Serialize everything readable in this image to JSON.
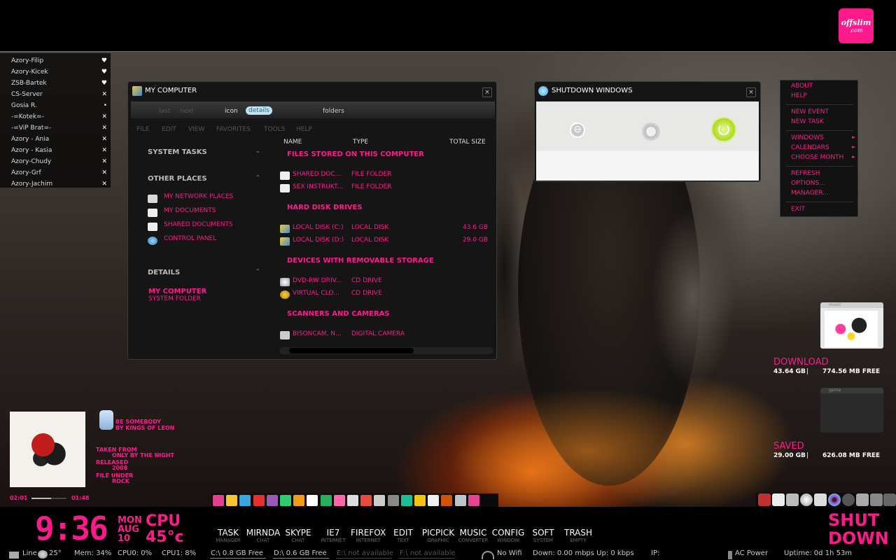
{
  "logo": {
    "line1": "offslim",
    "line2": ".com"
  },
  "buddies": [
    {
      "name": "Azory-Filip",
      "status": "♥"
    },
    {
      "name": "Azory-Kicek",
      "status": "♥"
    },
    {
      "name": "ZSB-Bartek",
      "status": "♥"
    },
    {
      "name": "CS-Server",
      "status": "✕"
    },
    {
      "name": "Gosia R.",
      "status": "•"
    },
    {
      "name": "-=Kotek=-",
      "status": "✕"
    },
    {
      "name": "-=ViP Brat=-",
      "status": "✕"
    },
    {
      "name": "Azory - Ania",
      "status": "✕"
    },
    {
      "name": "Azory - Kasia",
      "status": "✕"
    },
    {
      "name": "Azory-Chudy",
      "status": "✕"
    },
    {
      "name": "Azory-Grf",
      "status": "✕"
    },
    {
      "name": "Azory-Jachim",
      "status": "✕"
    }
  ],
  "my_computer": {
    "title": "MY COMPUTER",
    "close": "×",
    "nav": {
      "last": "last",
      "next": "next",
      "icon": "icon",
      "details": "details",
      "folders": "folders"
    },
    "menu": [
      "FILE",
      "EDIT",
      "VIEW",
      "FAVORITES",
      "TOOLS",
      "HELP"
    ],
    "sidebar": {
      "system_tasks": "SYSTEM TASKS",
      "other_places": "OTHER PLACES",
      "places": [
        "MY NETWORK PLACES",
        "MY DOCUMENTS",
        "SHARED DOCUMENTS",
        "CONTROL PANEL"
      ],
      "details": "DETAILS",
      "detail_title": "MY COMPUTER",
      "detail_sub": "SYSTEM FOLDER"
    },
    "columns": {
      "name": "NAME",
      "type": "TYPE",
      "size": "TOTAL SIZE"
    },
    "sections": [
      {
        "title": "FILES STORED ON THIS COMPUTER",
        "rows": [
          {
            "name": "SHARED DOC...",
            "type": "FILE FOLDER",
            "size": ""
          },
          {
            "name": "SEX INSTRUKT...",
            "type": "FILE FOLDER",
            "size": ""
          }
        ]
      },
      {
        "title": "HARD DISK DRIVES",
        "rows": [
          {
            "name": "LOCAL DISK (C:)",
            "type": "LOCAL DISK",
            "size": "43.6 GB"
          },
          {
            "name": "LOCAL DISK (D:)",
            "type": "LOCAL DISK",
            "size": "29.0 GB"
          }
        ]
      },
      {
        "title": "DEVICES WITH REMOVABLE STORAGE",
        "rows": [
          {
            "name": "DVD-RW DRIV...",
            "type": "CD DRIVE",
            "size": ""
          },
          {
            "name": "VIRTUAL CLO...",
            "type": "CD DRIVE",
            "size": ""
          }
        ]
      },
      {
        "title": "SCANNERS AND CAMERAS",
        "rows": [
          {
            "name": "BISONCAM, N...",
            "type": "DIGITAL CAMERA",
            "size": ""
          }
        ]
      }
    ]
  },
  "shutdown": {
    "title": "SHUTDOWN WINDOWS",
    "close": "×"
  },
  "context_menu": {
    "about": "ABOUT",
    "help": "HELP",
    "new_event": "NEW EVENT",
    "new_task": "NEW TASK",
    "windows": "WINDOWS",
    "calendars": "CALENDARS",
    "choose_month": "CHOOSE MONTH",
    "refresh": "REFRESH",
    "options": "OPTIONS...",
    "manager": "MANAGER...",
    "exit": "EXIT",
    "arrow": "►"
  },
  "drives": {
    "download_label": "DOWNLOAD",
    "download_used": "43.64 GB",
    "download_free": "774.56 MB FREE",
    "saved_label": "SAVED",
    "saved_used": "29.00 GB",
    "saved_free": "626.08 MB FREE",
    "sep": "|",
    "folder_tab": "music",
    "folder_tab2": "game"
  },
  "music": {
    "song": "BE SOMEBODY",
    "artist": "BY KINGS OF LEON",
    "taken_label": "TAKEN FROM",
    "album": "ONLY BY THE NIGHT",
    "released_label": "RELEASED",
    "year": "2008",
    "genre_label": "FILE UNDER",
    "genre": "ROCK",
    "elapsed": "02:01",
    "remaining": "01:48",
    "progress": 0.55
  },
  "clock": {
    "time": "9:36",
    "day": "MON",
    "month": "AUG",
    "date": "10",
    "cpu_label": "CPU",
    "cpu": "45°c"
  },
  "taskbar": [
    {
      "main": "TASK",
      "sub": "MANAGER"
    },
    {
      "main": "MIRNDA",
      "sub": "CHAT"
    },
    {
      "main": "SKYPE",
      "sub": "CHAT"
    },
    {
      "main": "IE7",
      "sub": "INTERNET"
    },
    {
      "main": "FIREFOX",
      "sub": "INTERNET"
    },
    {
      "main": "EDIT",
      "sub": "TEXT"
    },
    {
      "main": "PICPICK",
      "sub": "GRAPHIC"
    },
    {
      "main": "MUSIC",
      "sub": "CONVERTER"
    },
    {
      "main": "CONFIG",
      "sub": "WINDOW"
    },
    {
      "main": "SOFT",
      "sub": "SYSTEM"
    },
    {
      "main": "TRASH",
      "sub": "EMPTY"
    }
  ],
  "shutdown_btn": {
    "line1": "SHUT",
    "line2": "DOWN"
  },
  "status": {
    "line": "Line",
    "temp": "25°",
    "mem": "Mem: 34%",
    "cpu0": "CPU0: 0%",
    "cpu1": "CPU1: 8%",
    "c": "C:\\ 0.8 GB Free",
    "d": "D:\\ 0.6 GB Free",
    "e": "E:\\ not available",
    "f": "F:\\ not available",
    "wifi": "No Wifi",
    "net": "Down: 0.00 mbps Up: 0 kbps",
    "ip": "IP:",
    "power": "AC Power",
    "uptime": "Uptime: 0d 1h 53m"
  },
  "colors": {
    "accent": "#ff1a8c",
    "power_green": "#b5e02a"
  }
}
